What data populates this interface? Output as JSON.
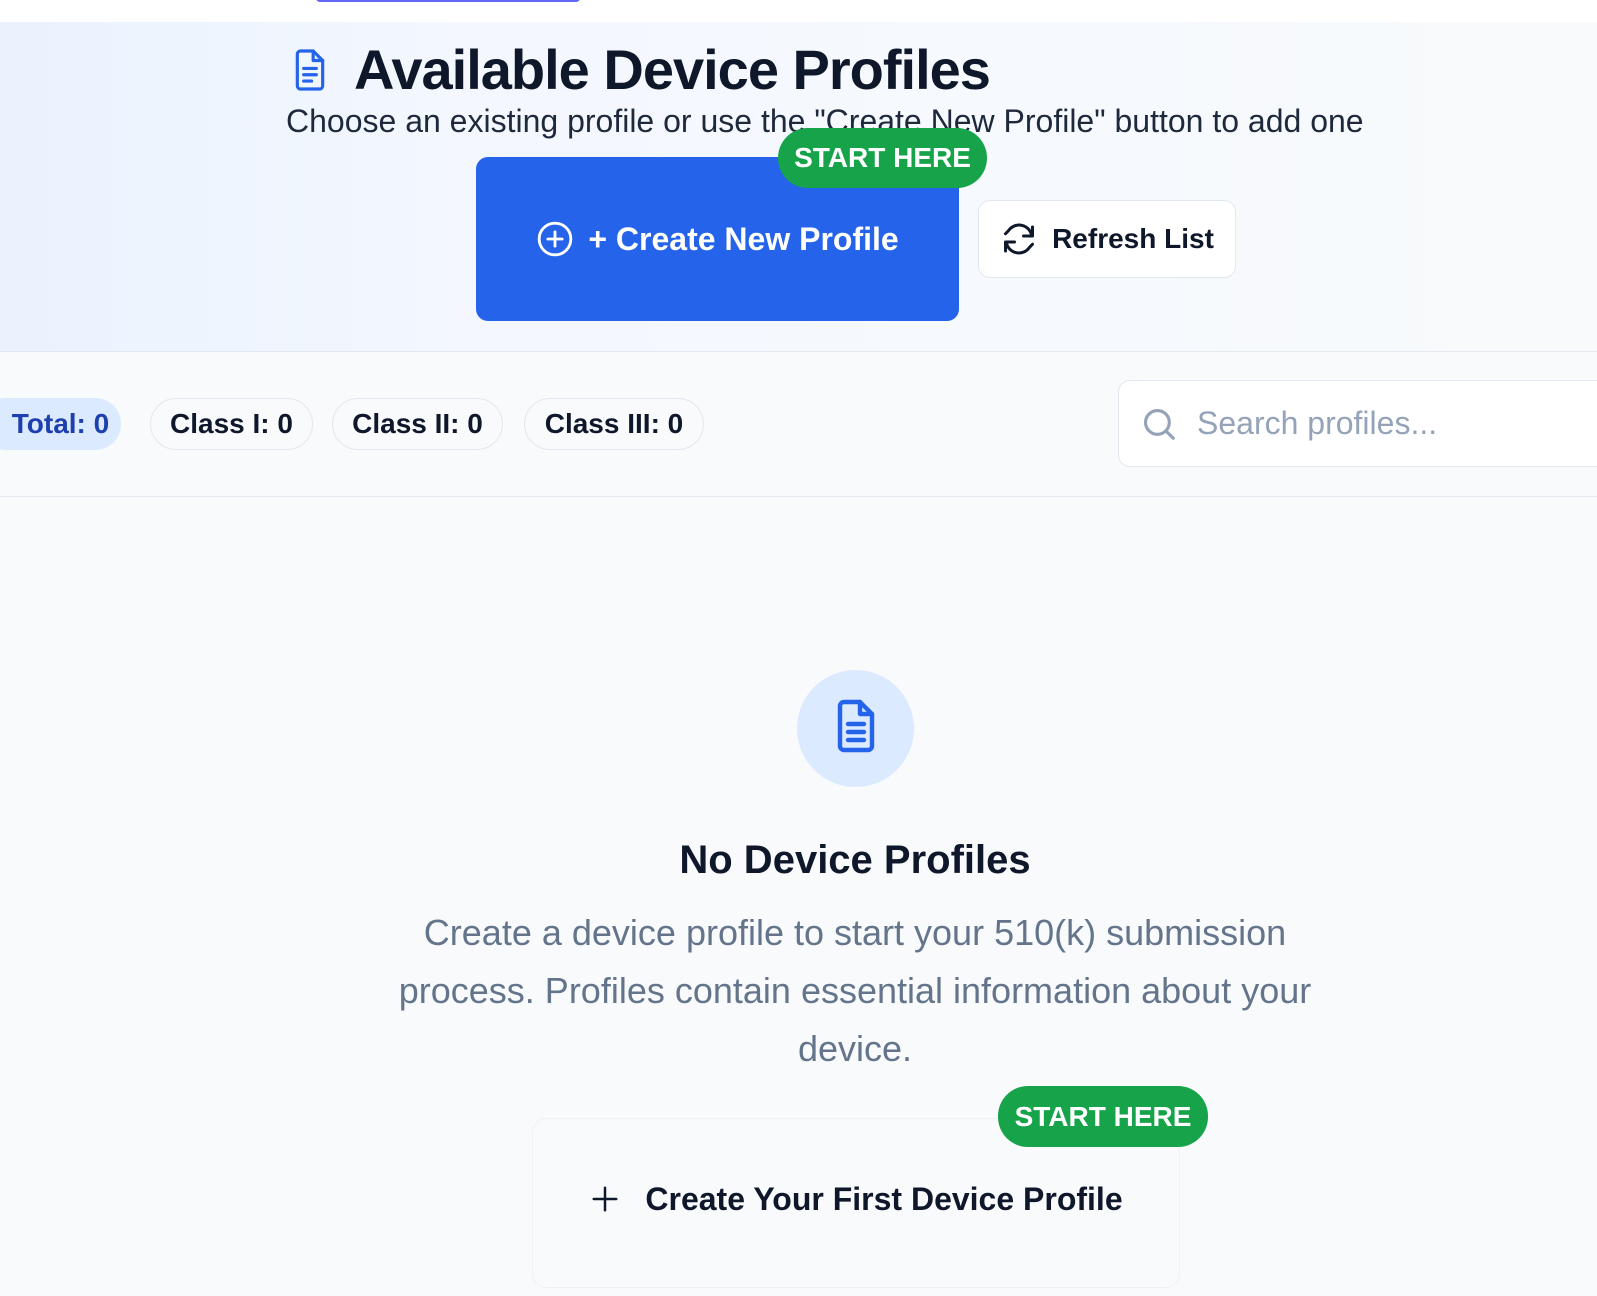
{
  "header": {
    "title": "Available Device Profiles",
    "subtitle": "Choose an existing profile or use the \"Create New Profile\" button to add one",
    "title_icon": "document-icon",
    "create_button": {
      "label": "+ Create New Profile",
      "icon": "plus-circle-icon"
    },
    "start_badge": "START HERE",
    "refresh_button": {
      "label": "Refresh List",
      "icon": "refresh-icon"
    }
  },
  "stats": {
    "total": "Total: 0",
    "class_i": "Class I: 0",
    "class_ii": "Class II: 0",
    "class_iii": "Class III: 0"
  },
  "search": {
    "placeholder": "Search profiles...",
    "value": "",
    "icon": "search-icon"
  },
  "empty_state": {
    "icon": "document-icon",
    "title": "No Device Profiles",
    "description": "Create a device profile to start your 510(k) submission process. Profiles contain essential information about your device.",
    "start_badge": "START HERE",
    "create_first_button": {
      "label": "Create Your First Device Profile",
      "icon": "plus-icon"
    }
  },
  "colors": {
    "primary": "#2563eb",
    "badge_green": "#16a34a",
    "chip_blue_bg": "#dbeafe",
    "chip_blue_text": "#1e40af",
    "muted_text": "#64748b"
  }
}
